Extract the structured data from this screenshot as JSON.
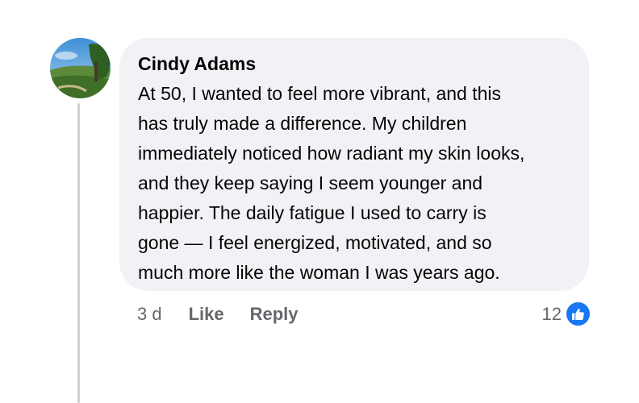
{
  "comment": {
    "author": "Cindy Adams",
    "lines": [
      "At 50, I wanted to feel more vibrant, and this",
      "has truly made a difference. My children",
      "immediately noticed how radiant my skin looks,",
      "and they keep saying I seem younger and",
      "happier. The daily fatigue I used to carry is",
      "gone — I feel energized, motivated, and so",
      "much more like the woman I was years ago."
    ],
    "timestamp": "3 d",
    "like_label": "Like",
    "reply_label": "Reply",
    "reaction_count": "12",
    "reaction_icon": "thumbs-up-icon",
    "colors": {
      "bubble": "#f0f2f5",
      "meta_text": "#65676b",
      "like_badge": "#1877f2"
    }
  }
}
